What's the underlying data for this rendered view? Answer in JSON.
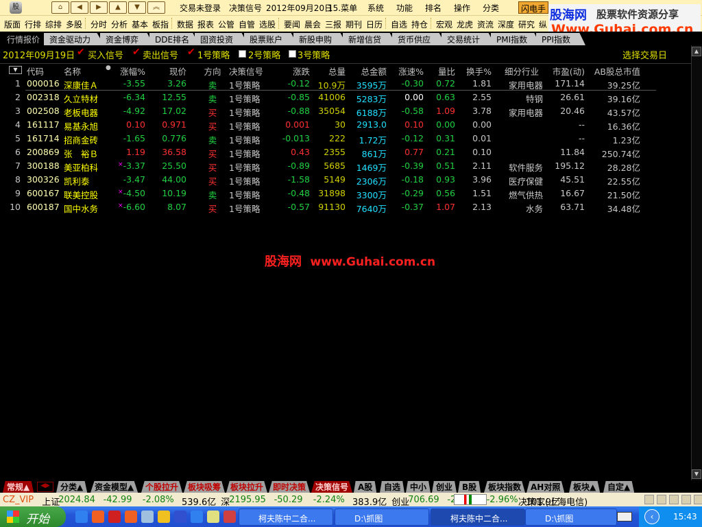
{
  "topbar": {
    "status": "交易未登录",
    "module": "决策信号",
    "date": "2012年09月20日",
    "menu_hint": "15.菜单",
    "menus": [
      "系统",
      "功能",
      "排名",
      "操作",
      "分类"
    ],
    "flash_button": "闪电手"
  },
  "toolbar": {
    "groups": [
      [
        "版面",
        "行排",
        "综排",
        "多股"
      ],
      [
        "分时",
        "分析",
        "基本",
        "板指"
      ],
      [
        "数据",
        "报表",
        "公管",
        "自管",
        "选股"
      ],
      [
        "要闻",
        "晨会",
        "三报",
        "期刊",
        "日历"
      ],
      [
        "自选",
        "持仓"
      ],
      [
        "宏观",
        "龙虎",
        "资流",
        "深度",
        "研究",
        "纵"
      ]
    ]
  },
  "tabs": [
    "行情报价",
    "资金驱动力",
    "资金博弈",
    "DDE排名",
    "固资投资",
    "股票账户",
    "新股申购",
    "新增信贷",
    "货币供应",
    "交易统计",
    "PMI指数",
    "PPI指数"
  ],
  "watermark": {
    "logo": "股海网",
    "slogan": "股票软件资源分享",
    "url": "Www.Guhai.com.cn"
  },
  "filter": {
    "date": "2012年09月19日",
    "buy_signal": "买入信号",
    "sell_signal": "卖出信号",
    "strategy1": "1号策略",
    "strategy2": "2号策略",
    "strategy3": "3号策略",
    "strategy1_checked": true,
    "strategy2_checked": false,
    "strategy3_checked": false,
    "select_day": "选择交易日"
  },
  "table": {
    "headers": [
      "代码",
      "名称",
      "涨幅%",
      "现价",
      "方向",
      "决策信号",
      "涨跌",
      "总量",
      "总金额",
      "涨速%",
      "量比",
      "换手%",
      "细分行业",
      "市盈(动)",
      "AB股总市值"
    ],
    "rows": [
      [
        "1",
        "000016",
        "深康佳Ａ",
        "-3.55",
        "3.26",
        "卖",
        "1号策略",
        "-0.12",
        "10.9万",
        "3595万",
        "-0.30",
        "0.72",
        "1.81",
        "家用电器",
        "171.14",
        "39.25亿"
      ],
      [
        "2",
        "002318",
        "久立特材",
        "-6.34",
        "12.55",
        "卖",
        "1号策略",
        "-0.85",
        "41006",
        "5283万",
        "0.00",
        "0.63",
        "2.55",
        "特钢",
        "26.61",
        "39.16亿"
      ],
      [
        "3",
        "002508",
        "老板电器",
        "-4.92",
        "17.02",
        "买",
        "1号策略",
        "-0.88",
        "35054",
        "6188万",
        "-0.58",
        "1.09",
        "3.78",
        "家用电器",
        "20.46",
        "43.57亿"
      ],
      [
        "4",
        "161117",
        "易基永旭",
        "0.10",
        "0.971",
        "买",
        "1号策略",
        "0.001",
        "30",
        "2913.0",
        "0.10",
        "0.00",
        "0.00",
        "",
        "--",
        "16.36亿"
      ],
      [
        "5",
        "161714",
        "招商金砖",
        "-1.65",
        "0.776",
        "卖",
        "1号策略",
        "-0.013",
        "222",
        "1.72万",
        "-0.12",
        "0.31",
        "0.01",
        "",
        "--",
        "1.23亿"
      ],
      [
        "6",
        "200869",
        "张　裕Ｂ",
        "1.19",
        "36.58",
        "买",
        "1号策略",
        "0.43",
        "2355",
        "861万",
        "0.77",
        "0.21",
        "0.10",
        "",
        "11.84",
        "250.74亿"
      ],
      [
        "7",
        "300188",
        "美亚柏科",
        "-3.37",
        "25.50",
        "买",
        "1号策略",
        "-0.89",
        "5685",
        "1469万",
        "-0.39",
        "0.51",
        "2.11",
        "软件服务",
        "195.12",
        "28.28亿"
      ],
      [
        "8",
        "300326",
        "凯利泰",
        "-3.47",
        "44.00",
        "买",
        "1号策略",
        "-1.58",
        "5149",
        "2306万",
        "-0.18",
        "0.93",
        "3.96",
        "医疗保健",
        "45.51",
        "22.55亿"
      ],
      [
        "9",
        "600167",
        "联美控股",
        "-4.50",
        "10.19",
        "卖",
        "1号策略",
        "-0.48",
        "31898",
        "3300万",
        "-0.29",
        "0.56",
        "1.51",
        "燃气供热",
        "16.67",
        "21.50亿"
      ],
      [
        "10",
        "600187",
        "国中水务",
        "-6.60",
        "8.07",
        "买",
        "1号策略",
        "-0.57",
        "91130",
        "7640万",
        "-0.37",
        "1.07",
        "2.13",
        "水务",
        "63.71",
        "34.48亿"
      ]
    ],
    "flagged_rows": [
      7,
      9,
      10
    ]
  },
  "center_watermark": {
    "logo": "股海网",
    "url": "www.Guhai.com.cn"
  },
  "bottom_tabs": [
    "常规▲",
    "分类▲",
    "资金模型▲",
    "个股拉升",
    "板块吸筹",
    "板块拉升",
    "即时决策",
    "决策信号",
    "A股",
    "自选",
    "中小",
    "创业",
    "B股",
    "板块指数",
    "AH对照",
    "板块▲",
    "自定▲"
  ],
  "status": {
    "user": "CZ_VIP",
    "sh_label": "上证",
    "sh_index": "2024.84",
    "sh_change": "-42.99",
    "sh_pct": "-2.08%",
    "sh_amount": "539.6亿",
    "sz_label": "深",
    "sz_index": "2195.95",
    "sz_change": "-50.29",
    "sz_pct": "-2.24%",
    "sz_amount": "383.9亿",
    "cy_label": "创业",
    "cy_index": "706.69",
    "cy_change": "-21.56",
    "cy_pct": "-2.96%",
    "cy_amount": "101.9亿",
    "server": "决策家(上海电信)"
  },
  "taskbar": {
    "start": "开始",
    "tasks": [
      "柯夫陈中二合...",
      "D:\\抓图",
      "柯夫陈中二合...",
      "D:\\抓图"
    ],
    "clock": "15:43"
  },
  "colors": {
    "up": "#ff3030",
    "down": "#20d040",
    "name": "#ffff00",
    "volume": "#d0d000",
    "amount": "#20e0ff",
    "neutral": "#c8c8c8",
    "background": "#000000"
  }
}
